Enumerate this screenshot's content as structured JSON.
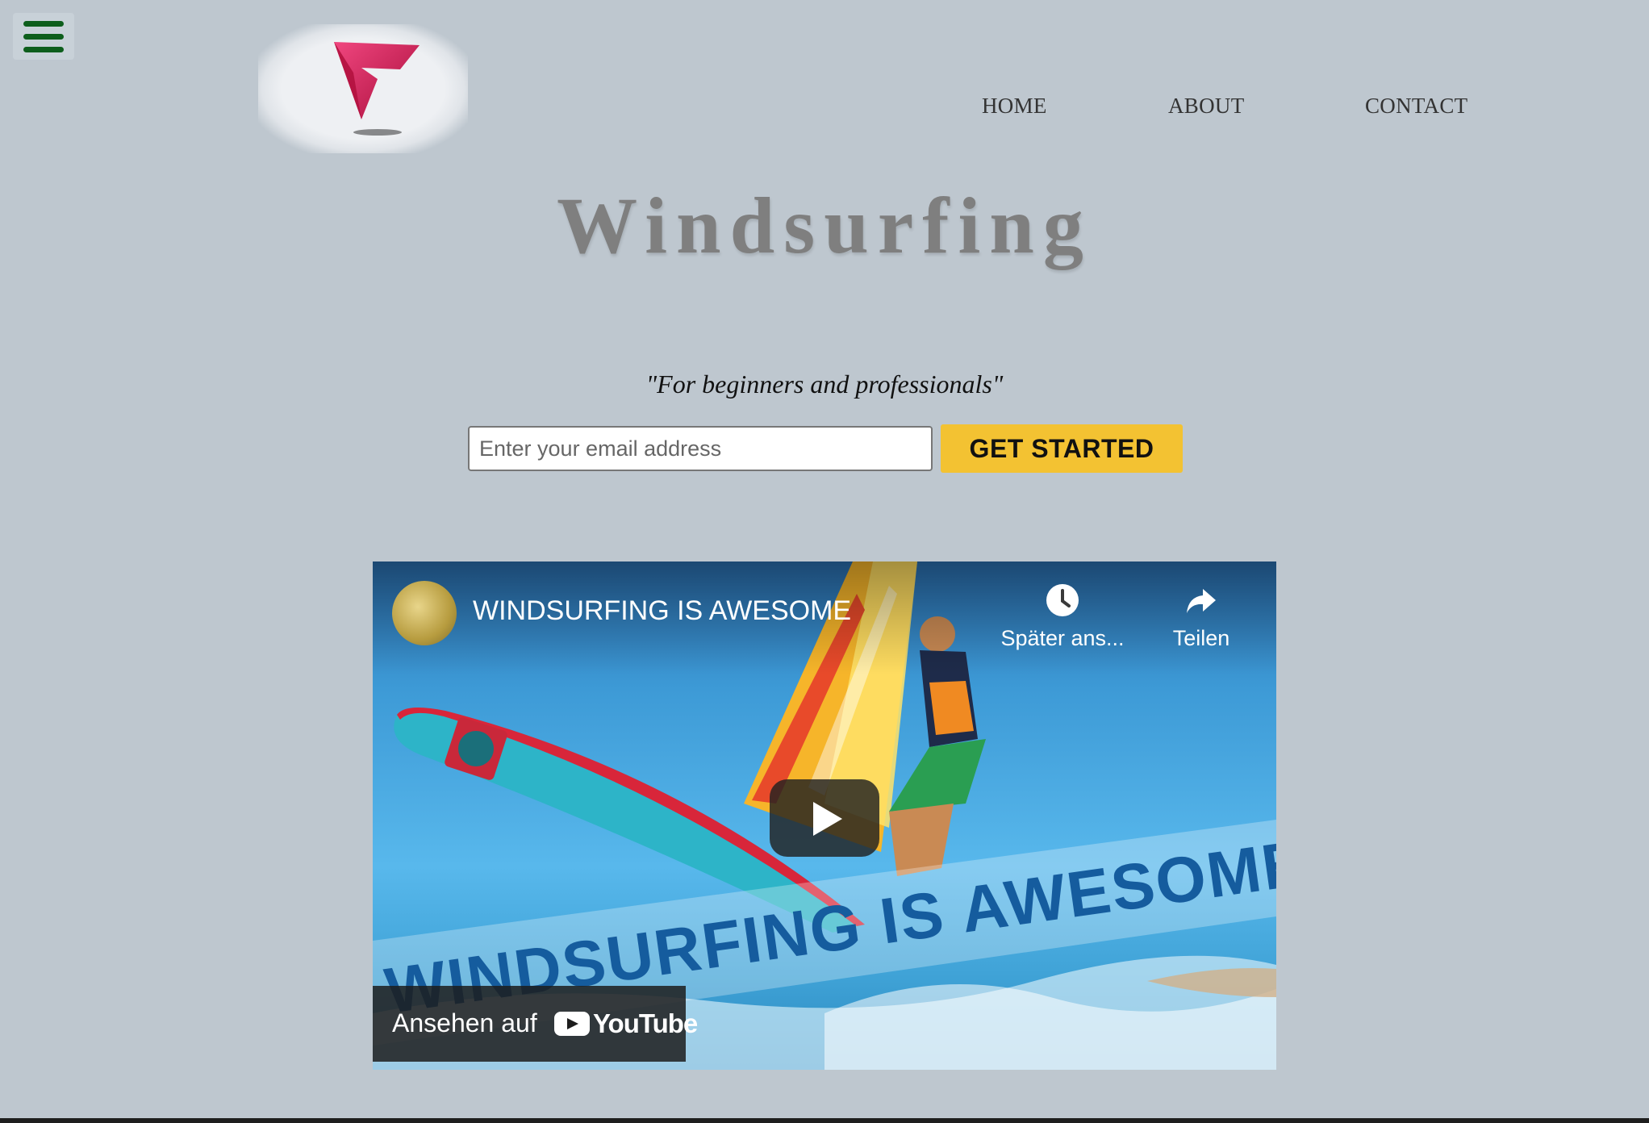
{
  "header": {
    "menu_icon": "hamburger-menu-icon",
    "logo_icon": "brand-v-logo",
    "nav": [
      {
        "label": "HOME"
      },
      {
        "label": "ABOUT"
      },
      {
        "label": "CONTACT"
      }
    ]
  },
  "hero": {
    "title": "Windsurfing",
    "tagline": "\"For beginners and professionals\"",
    "email_placeholder": "Enter your email address",
    "cta_label": "GET STARTED"
  },
  "video": {
    "title": "WINDSURFING IS AWESOME",
    "overlay_text": "WINDSURFING IS AWESOME",
    "watch_later_label": "Später ans...",
    "share_label": "Teilen",
    "watch_on_label": "Ansehen auf",
    "platform_name": "YouTube"
  },
  "colors": {
    "background": "#bec7cf",
    "accent": "#f3c232",
    "menu_icon": "#0d5e1c",
    "logo": "#d4144f"
  }
}
